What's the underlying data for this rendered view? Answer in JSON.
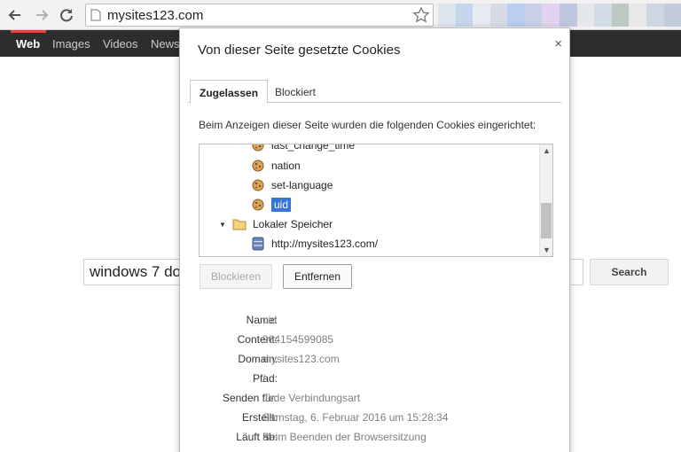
{
  "browser": {
    "url": "mysites123.com",
    "blur_colors": [
      "#dfe5ee",
      "#c5d5ec",
      "#e8eaf0",
      "#d7dbe6",
      "#b8cdf0",
      "#c8d0e8",
      "#e2d3ee",
      "#bfc7e0",
      "#e6e7eb",
      "#d3dbe8",
      "#bcc8c0",
      "#e8e8e8",
      "#cfd6e2",
      "#c2cbd9"
    ]
  },
  "site_nav": {
    "tabs": [
      "Web",
      "Images",
      "Videos",
      "News"
    ],
    "accent_color": "#dd4b39"
  },
  "background": {
    "search_value": "windows 7 do",
    "search_button": "Search"
  },
  "dialog": {
    "title": "Von dieser Seite gesetzte Cookies",
    "close_label": "×",
    "tabs": [
      "Zugelassen",
      "Blockiert"
    ],
    "description": "Beim Anzeigen dieser Seite wurden die folgenden Cookies eingerichtet:",
    "tree": {
      "items": [
        {
          "label": "last_change_time",
          "icon": "cookie-icon"
        },
        {
          "label": "nation",
          "icon": "cookie-icon"
        },
        {
          "label": "set-language",
          "icon": "cookie-icon"
        },
        {
          "label": "uid",
          "icon": "cookie-icon",
          "selected": true
        },
        {
          "label": "Lokaler Speicher",
          "icon": "folder-icon"
        },
        {
          "label": "http://mysites123.com/",
          "icon": "database-icon"
        }
      ]
    },
    "buttons": {
      "block": "Blockieren",
      "remove": "Entfernen"
    },
    "details": [
      {
        "key": "Name:",
        "value": "uid"
      },
      {
        "key": "Content:",
        "value": "964154599085"
      },
      {
        "key": "Domain:",
        "value": "mysites123.com"
      },
      {
        "key": "Pfad:",
        "value": "/"
      },
      {
        "key": "Senden für:",
        "value": "Jede Verbindungsart"
      },
      {
        "key": "Erstellt:",
        "value": "Samstag, 6. Februar 2016 um 15:28:34"
      },
      {
        "key": "Läuft ab:",
        "value": "Beim Beenden der Browsersitzung"
      }
    ]
  }
}
